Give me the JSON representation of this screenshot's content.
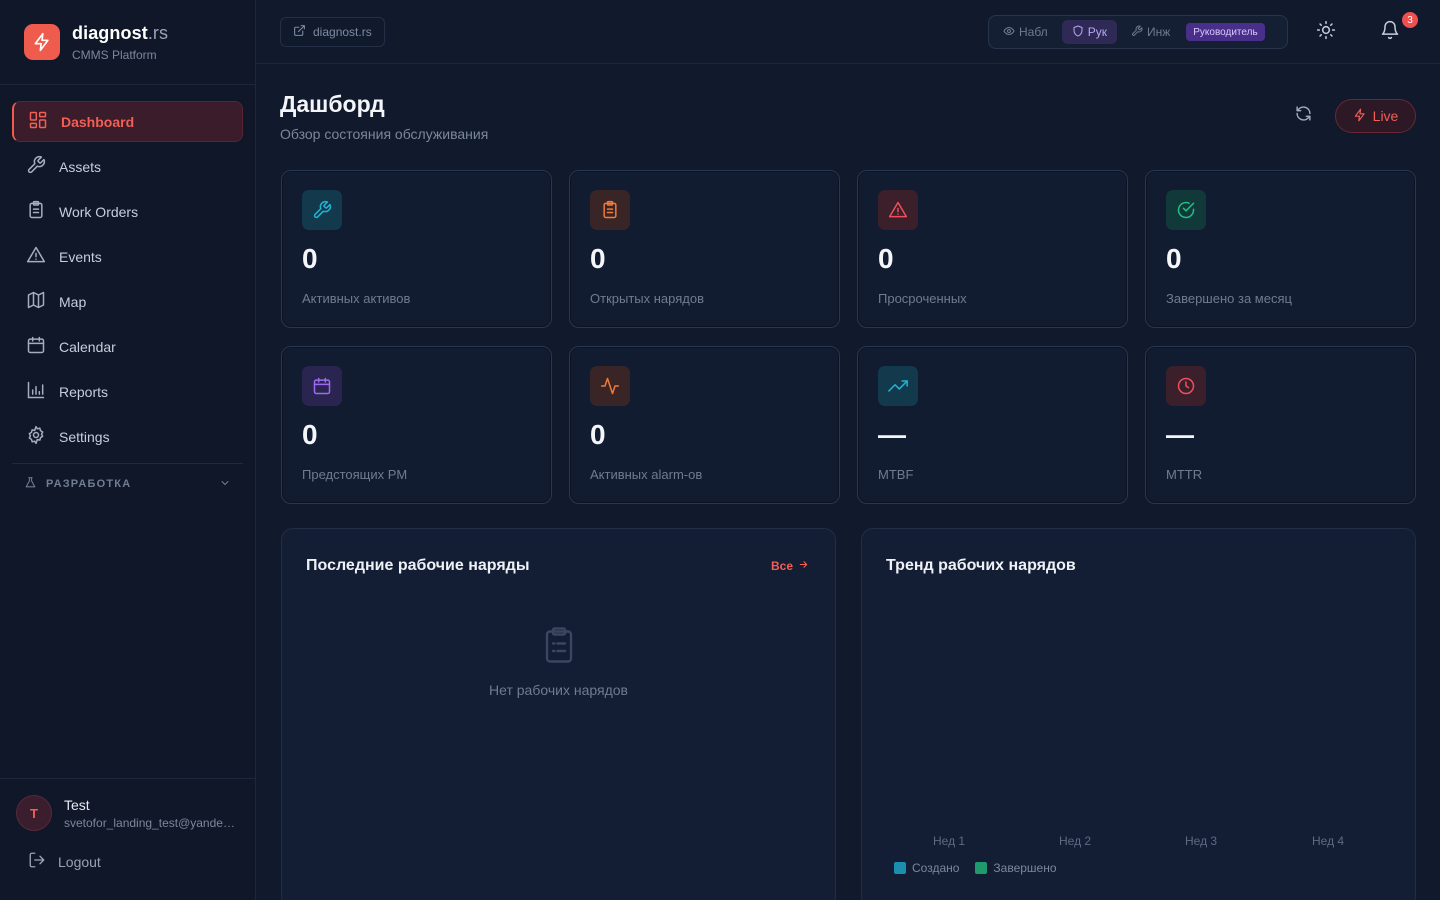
{
  "brand": {
    "name": "diagnost",
    "tld": ".rs",
    "subtitle": "CMMS Platform"
  },
  "sidebar": {
    "items": [
      {
        "label": "Dashboard",
        "icon": "dashboard-grid-icon",
        "active": true
      },
      {
        "label": "Assets",
        "icon": "wrench-icon"
      },
      {
        "label": "Work Orders",
        "icon": "clipboard-icon"
      },
      {
        "label": "Events",
        "icon": "warning-triangle-icon"
      },
      {
        "label": "Map",
        "icon": "map-icon"
      },
      {
        "label": "Calendar",
        "icon": "calendar-icon"
      },
      {
        "label": "Reports",
        "icon": "bar-chart-icon"
      },
      {
        "label": "Settings",
        "icon": "gear-icon"
      }
    ],
    "dev_group": "РАЗРАБОТКА"
  },
  "user": {
    "initial": "T",
    "name": "Test",
    "email": "svetofor_landing_test@yandex.ru",
    "logout_label": "Logout"
  },
  "topbar": {
    "site_chip": "diagnost.rs",
    "roles": [
      {
        "label": "Набл",
        "icon": "eye-icon",
        "active": false
      },
      {
        "label": "Рук",
        "icon": "shield-icon",
        "active": true
      },
      {
        "label": "Инж",
        "icon": "wrench-icon",
        "active": false
      }
    ],
    "role_badge": "Руководитель",
    "notifications_count": "3"
  },
  "page": {
    "title": "Дашборд",
    "subtitle": "Обзор состояния обслуживания",
    "live_label": "Live"
  },
  "stats": [
    {
      "value": "0",
      "label": "Активных активов",
      "icon": "wrench-icon",
      "color": "#22b3d4"
    },
    {
      "value": "0",
      "label": "Открытых нарядов",
      "icon": "clipboard-icon",
      "color": "#f07a3a"
    },
    {
      "value": "0",
      "label": "Просроченных",
      "icon": "warning-triangle-icon",
      "color": "#ef4f5a"
    },
    {
      "value": "0",
      "label": "Завершено за месяц",
      "icon": "check-circle-icon",
      "color": "#1fbf83"
    },
    {
      "value": "0",
      "label": "Предстоящих PM",
      "icon": "calendar-icon",
      "color": "#9b6cf0"
    },
    {
      "value": "0",
      "label": "Активных alarm-ов",
      "icon": "activity-icon",
      "color": "#f07a3a"
    },
    {
      "value": "—",
      "label": "MTBF",
      "icon": "trending-up-icon",
      "color": "#22b3d4"
    },
    {
      "value": "—",
      "label": "MTTR",
      "icon": "clock-icon",
      "color": "#ef4f5a"
    }
  ],
  "recent_orders": {
    "title": "Последние рабочие наряды",
    "link_label": "Все",
    "empty_text": "Нет рабочих нарядов"
  },
  "trend": {
    "title": "Тренд рабочих нарядов",
    "chart_data": {
      "type": "bar",
      "categories": [
        "Нед 1",
        "Нед 2",
        "Нед 3",
        "Нед 4"
      ],
      "series": [
        {
          "name": "Создано",
          "color": "#1a8fae",
          "values": [
            0,
            0,
            0,
            0
          ]
        },
        {
          "name": "Завершено",
          "color": "#1f9a6c",
          "values": [
            0,
            0,
            0,
            0
          ]
        }
      ]
    }
  }
}
